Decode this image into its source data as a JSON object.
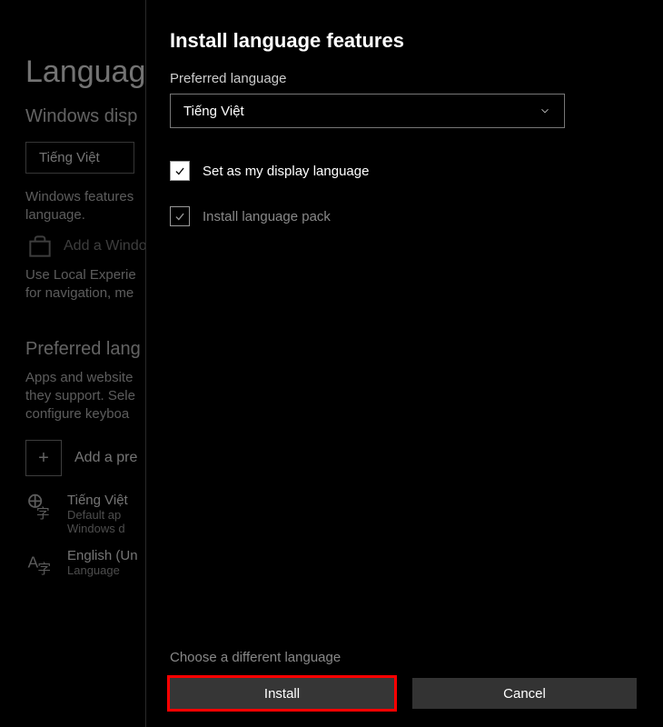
{
  "background": {
    "page_title": "Language",
    "display_section": "Windows disp",
    "display_value": "Tiếng Việt",
    "display_desc": "Windows features\nlanguage.",
    "store_link": "Add a Windo",
    "local_exp": "Use Local Experie\nfor navigation, me",
    "preferred_section": "Preferred lang",
    "preferred_desc": "Apps and website\nthey support. Sele\nconfigure keyboa",
    "add_preferred": "Add a pre",
    "lang1_name": "Tiếng Việt",
    "lang1_sub": "Default ap\nWindows d",
    "lang2_name": "English (Un",
    "lang2_sub": "Language"
  },
  "modal": {
    "title": "Install language features",
    "field_label": "Preferred language",
    "selected_language": "Tiếng Việt",
    "option_display": "Set as my display language",
    "option_pack": "Install language pack",
    "different_link": "Choose a different language",
    "install_btn": "Install",
    "cancel_btn": "Cancel"
  }
}
